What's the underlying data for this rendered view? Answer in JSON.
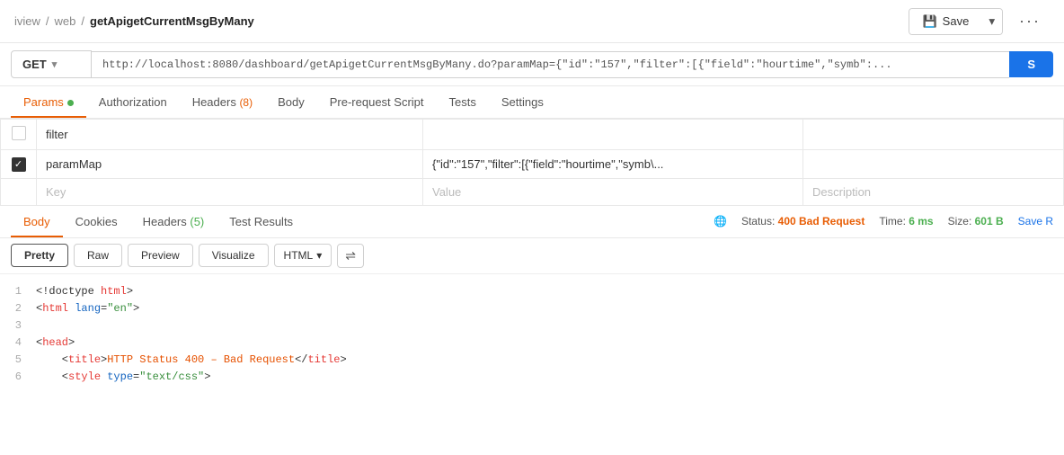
{
  "breadcrumb": {
    "part1": "iview",
    "sep1": "/",
    "part2": "web",
    "sep2": "/",
    "part3": "getApigetCurrentMsgByMany"
  },
  "toolbar": {
    "save_label": "Save",
    "more_label": "···"
  },
  "url_bar": {
    "method": "GET",
    "url": "http://localhost:8080/dashboard/getApigetCurrentMsgByMany.do?paramMap={\"id\":\"157\",\"filter\":[{\"field\":\"hourtime\",\"symb\":...",
    "send_label": "S"
  },
  "request_tabs": [
    {
      "label": "Params",
      "active": true,
      "dot": true
    },
    {
      "label": "Authorization",
      "active": false
    },
    {
      "label": "Headers",
      "badge": "(8)",
      "active": false
    },
    {
      "label": "Body",
      "active": false
    },
    {
      "label": "Pre-request Script",
      "active": false
    },
    {
      "label": "Tests",
      "active": false
    },
    {
      "label": "Settings",
      "active": false
    }
  ],
  "params": [
    {
      "checked": false,
      "key": "filter",
      "value": "",
      "description": ""
    },
    {
      "checked": true,
      "key": "paramMap",
      "value": "{\"id\":\"157\",\"filter\":[{\"field\":\"hourtime\",\"symb\\...",
      "description": ""
    }
  ],
  "params_placeholder": {
    "key": "Key",
    "value": "Value",
    "description": "Description"
  },
  "response_tabs": [
    {
      "label": "Body",
      "active": true
    },
    {
      "label": "Cookies",
      "active": false
    },
    {
      "label": "Headers",
      "badge": "(5)",
      "active": false
    },
    {
      "label": "Test Results",
      "active": false
    }
  ],
  "response_status": {
    "globe": "🌐",
    "status_label": "Status:",
    "status_value": "400 Bad Request",
    "time_label": "Time:",
    "time_value": "6 ms",
    "size_label": "Size:",
    "size_value": "601 B",
    "save_label": "Save R"
  },
  "code_toolbar": {
    "pretty": "Pretty",
    "raw": "Raw",
    "preview": "Preview",
    "visualize": "Visualize",
    "format": "HTML",
    "wrap_icon": "⇔"
  },
  "code_lines": [
    {
      "num": "1",
      "content": "<!doctype html>",
      "type": "tag"
    },
    {
      "num": "2",
      "content": "<html lang=\"en\">",
      "type": "tag"
    },
    {
      "num": "3",
      "content": "",
      "type": "empty"
    },
    {
      "num": "4",
      "content": "<head>",
      "type": "tag"
    },
    {
      "num": "5",
      "content": "    <title>HTTP Status 400 – Bad Request</title>",
      "type": "tag_title"
    },
    {
      "num": "6",
      "content": "    <style type=\"text/css\">",
      "type": "tag_style"
    }
  ]
}
